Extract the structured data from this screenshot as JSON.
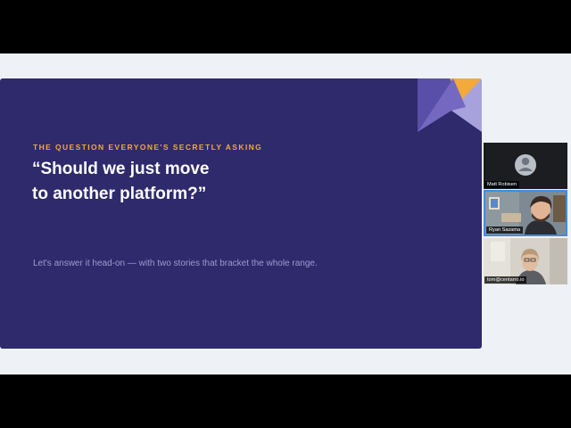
{
  "slide": {
    "eyebrow": "THE QUESTION EVERYONE'S SECRETLY ASKING",
    "headline_line1": "“Should we just move",
    "headline_line2": "to another platform?”",
    "subtext": "Let's answer it head-on — with two stories that bracket the whole range.",
    "colors": {
      "background": "#2e2a6b",
      "accent": "#f3a93b",
      "headline": "#ffffff",
      "subtext": "#9e9ad2"
    }
  },
  "participants": [
    {
      "name": "Matt Robisen",
      "video": "avatar-placeholder-icon"
    },
    {
      "name": "Ryan Sazama",
      "video": "camera-feed",
      "active_speaker": true
    },
    {
      "name": "tom@centarro.io",
      "video": "camera-feed"
    }
  ]
}
